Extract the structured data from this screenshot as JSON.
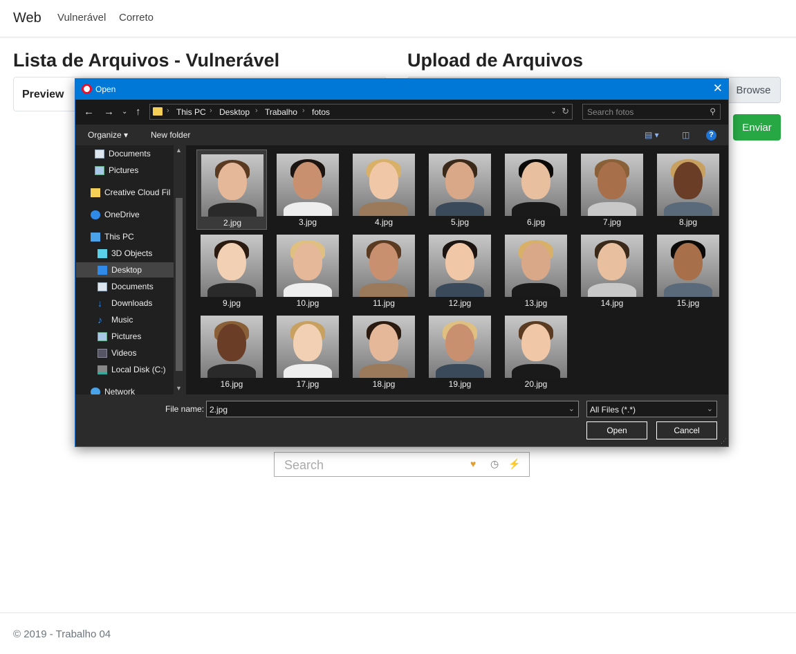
{
  "nav": {
    "brand": "Web",
    "links": [
      "Vulnerável",
      "Correto"
    ]
  },
  "left": {
    "heading": "Lista de Arquivos - Vulnerável",
    "tab": "Preview"
  },
  "right": {
    "heading": "Upload de Arquivos",
    "browse": "Browse",
    "submit": "Enviar"
  },
  "searchbar": {
    "placeholder": "Search"
  },
  "footer": "© 2019 - Trabalho 04",
  "dialog": {
    "title": "Open",
    "path": [
      "This PC",
      "Desktop",
      "Trabalho",
      "fotos"
    ],
    "search_placeholder": "Search fotos",
    "toolbar": {
      "organize": "Organize",
      "new_folder": "New folder"
    },
    "nav_items": [
      {
        "label": "Documents",
        "icon": "documents-icon",
        "pinned": true
      },
      {
        "label": "Pictures",
        "icon": "pictures-icon",
        "pinned": true
      },
      {
        "label": "Creative Cloud Fil",
        "icon": "creative-cloud-icon"
      },
      {
        "label": "OneDrive",
        "icon": "onedrive-icon"
      },
      {
        "label": "This PC",
        "icon": "this-pc-icon"
      },
      {
        "label": "3D Objects",
        "icon": "3d-objects-icon"
      },
      {
        "label": "Desktop",
        "icon": "desktop-icon",
        "selected": true
      },
      {
        "label": "Documents",
        "icon": "documents-icon"
      },
      {
        "label": "Downloads",
        "icon": "downloads-icon"
      },
      {
        "label": "Music",
        "icon": "music-icon"
      },
      {
        "label": "Pictures",
        "icon": "pictures-icon"
      },
      {
        "label": "Videos",
        "icon": "videos-icon"
      },
      {
        "label": "Local Disk (C:)",
        "icon": "local-disk-icon"
      },
      {
        "label": "Network",
        "icon": "network-icon"
      }
    ],
    "files": [
      "2.jpg",
      "3.jpg",
      "4.jpg",
      "5.jpg",
      "6.jpg",
      "7.jpg",
      "8.jpg",
      "9.jpg",
      "10.jpg",
      "11.jpg",
      "12.jpg",
      "13.jpg",
      "14.jpg",
      "15.jpg",
      "16.jpg",
      "17.jpg",
      "18.jpg",
      "19.jpg",
      "20.jpg"
    ],
    "selected_file": "2.jpg",
    "file_name_label": "File name:",
    "file_name_value": "2.jpg",
    "filter": "All Files (*.*)",
    "open_button": "Open",
    "cancel_button": "Cancel",
    "colors": {
      "titlebar": "#0078d7",
      "enviar": "#28a745"
    }
  }
}
